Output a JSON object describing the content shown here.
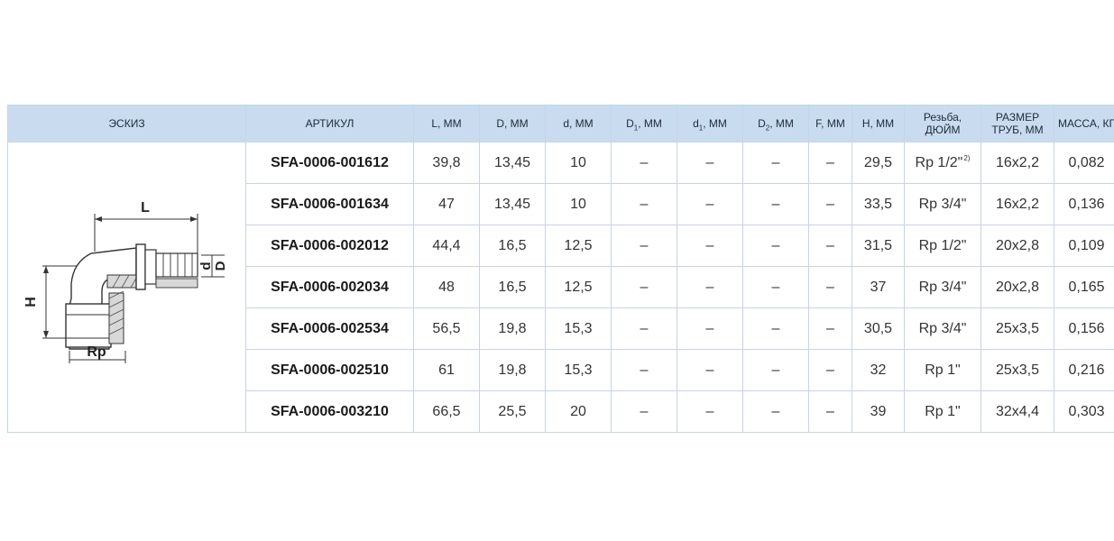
{
  "header": {
    "sketch": "ЭСКИЗ",
    "article": "АРТИКУЛ",
    "L": "L, ММ",
    "D": "D, ММ",
    "d": "d, ММ",
    "D1_main": "D",
    "D1_sub": "1",
    "D1_unit": ", ММ",
    "d1_main": "d",
    "d1_sub": "1",
    "d1_unit": ", ММ",
    "D2_main": "D",
    "D2_sub": "2",
    "D2_unit": ", ММ",
    "F": "F, ММ",
    "H": "H, ММ",
    "thread_line1": "Резьба,",
    "thread_line2": "ДЮЙМ",
    "pipe_line1": "РАЗМЕР",
    "pipe_line2": "ТРУБ, ММ",
    "mass": "МАССА, КГ"
  },
  "sketch_labels": {
    "L": "L",
    "H": "H",
    "d": "d",
    "D": "D",
    "Rp": "Rp"
  },
  "rows": [
    {
      "article": "SFA-0006-001612",
      "L": "39,8",
      "D": "13,45",
      "d": "10",
      "D1": "–",
      "d1": "–",
      "D2": "–",
      "F": "–",
      "H": "29,5",
      "thread": "Rp 1/2\"",
      "thread_note": "2)",
      "pipe": "16x2,2",
      "mass": "0,082"
    },
    {
      "article": "SFA-0006-001634",
      "L": "47",
      "D": "13,45",
      "d": "10",
      "D1": "–",
      "d1": "–",
      "D2": "–",
      "F": "–",
      "H": "33,5",
      "thread": "Rp 3/4\"",
      "thread_note": "",
      "pipe": "16x2,2",
      "mass": "0,136"
    },
    {
      "article": "SFA-0006-002012",
      "L": "44,4",
      "D": "16,5",
      "d": "12,5",
      "D1": "–",
      "d1": "–",
      "D2": "–",
      "F": "–",
      "H": "31,5",
      "thread": "Rp 1/2\"",
      "thread_note": "",
      "pipe": "20x2,8",
      "mass": "0,109"
    },
    {
      "article": "SFA-0006-002034",
      "L": "48",
      "D": "16,5",
      "d": "12,5",
      "D1": "–",
      "d1": "–",
      "D2": "–",
      "F": "–",
      "H": "37",
      "thread": "Rp 3/4\"",
      "thread_note": "",
      "pipe": "20x2,8",
      "mass": "0,165"
    },
    {
      "article": "SFA-0006-002534",
      "L": "56,5",
      "D": "19,8",
      "d": "15,3",
      "D1": "–",
      "d1": "–",
      "D2": "–",
      "F": "–",
      "H": "30,5",
      "thread": "Rp 3/4\"",
      "thread_note": "",
      "pipe": "25x3,5",
      "mass": "0,156"
    },
    {
      "article": "SFA-0006-002510",
      "L": "61",
      "D": "19,8",
      "d": "15,3",
      "D1": "–",
      "d1": "–",
      "D2": "–",
      "F": "–",
      "H": "32",
      "thread": "Rp 1\"",
      "thread_note": "",
      "pipe": "25x3,5",
      "mass": "0,216"
    },
    {
      "article": "SFA-0006-003210",
      "L": "66,5",
      "D": "25,5",
      "d": "20",
      "D1": "–",
      "d1": "–",
      "D2": "–",
      "F": "–",
      "H": "39",
      "thread": "Rp 1\"",
      "thread_note": "",
      "pipe": "32x4,4",
      "mass": "0,303"
    }
  ]
}
